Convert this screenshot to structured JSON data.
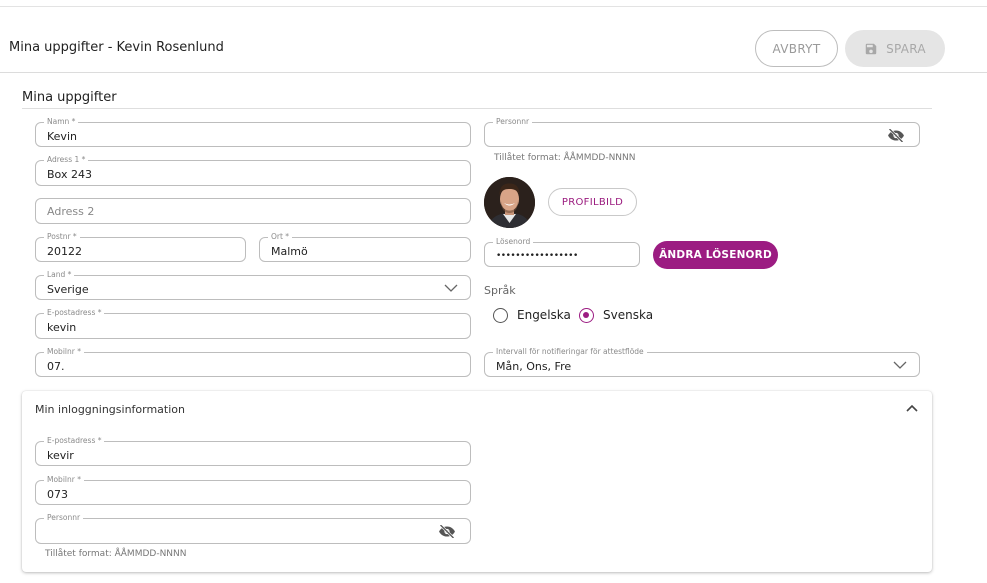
{
  "header": {
    "title": "Mina uppgifter - Kevin Rosenlund",
    "cancel_label": "AVBRYT",
    "save_label": "SPARA"
  },
  "section": {
    "title": "Mina uppgifter"
  },
  "fields": {
    "name": {
      "label": "Namn *",
      "value": "Kevin"
    },
    "address1": {
      "label": "Adress 1 *",
      "value": "Box 243"
    },
    "address2": {
      "placeholder": "Adress 2"
    },
    "postnr": {
      "label": "Postnr *",
      "value": "20122"
    },
    "ort": {
      "label": "Ort *",
      "value": "Malmö"
    },
    "land": {
      "label": "Land *",
      "value": "Sverige"
    },
    "email": {
      "label": "E-postadress *",
      "value": "kevin"
    },
    "mobile": {
      "label": "Mobilnr *",
      "value": "07."
    },
    "personnr": {
      "label": "Personnr",
      "value": ""
    },
    "personnr_hint": "Tillåtet format: ÅÅMMDD-NNNN",
    "password": {
      "label": "Lösenord",
      "value": "•••••••••••••••••"
    },
    "interval": {
      "label": "Intervall för notifieringar för attestflöde",
      "value": "Mån, Ons, Fre"
    }
  },
  "profile": {
    "button_label": "PROFILBILD"
  },
  "password_button_label": "ÄNDRA LÖSENORD",
  "language": {
    "label": "Språk",
    "options": [
      "Engelska",
      "Svenska"
    ],
    "selected": "Svenska"
  },
  "login_info": {
    "title": "Min inloggningsinformation",
    "email": {
      "label": "E-postadress *",
      "value": "kevir"
    },
    "mobile": {
      "label": "Mobilnr *",
      "value": "073"
    },
    "personnr": {
      "label": "Personnr",
      "value": ""
    },
    "personnr_hint": "Tillåtet format: ÅÅMMDD-NNNN"
  },
  "colors": {
    "accent": "#9c1c82",
    "border": "#bdbdbd",
    "disabled_bg": "#e5e5e5"
  },
  "icons": {
    "save": "floppy-disk-icon",
    "visibility_off": "eye-off-icon",
    "dropdown": "chevron-down-icon",
    "collapse": "chevron-up-icon"
  }
}
